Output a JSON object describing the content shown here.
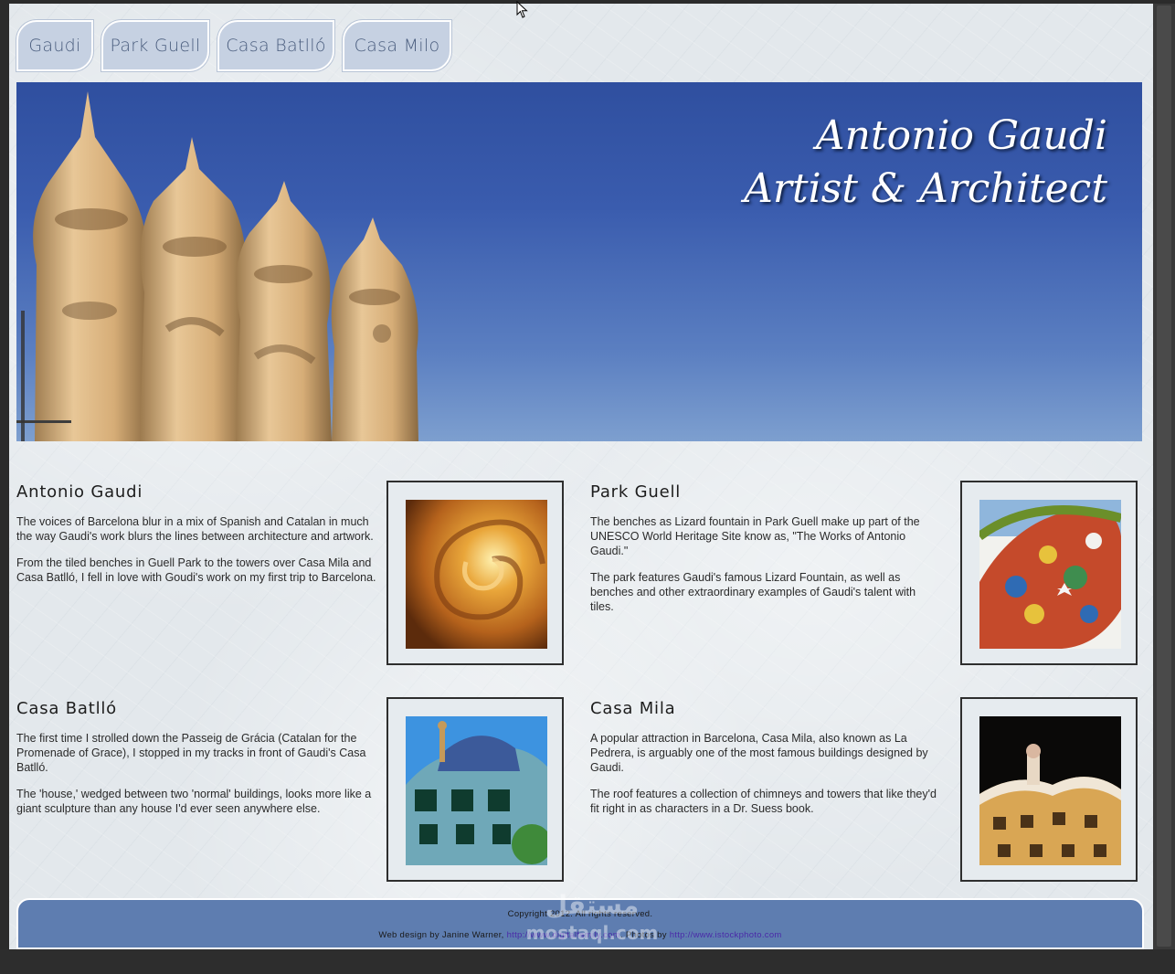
{
  "nav": {
    "tabs": [
      {
        "label": "Gaudi"
      },
      {
        "label": "Park Guell"
      },
      {
        "label": "Casa Batlló"
      },
      {
        "label": "Casa Milo"
      }
    ]
  },
  "hero": {
    "title_line1": "Antonio Gaudi",
    "title_line2": "Artist & Architect"
  },
  "articles": [
    {
      "heading": "Antonio Gaudi",
      "paragraphs": [
        "The voices of Barcelona blur in a mix of Spanish and Catalan in much the way Gaudi's work blurs the lines between architecture and artwork.",
        "From the tiled benches in Guell Park to the towers over Casa Mila and Casa Batlló, I fell in love with Goudi's work on my first trip to Barcelona."
      ]
    },
    {
      "heading": "Park Guell",
      "paragraphs": [
        "The benches as Lizard fountain in Park Guell make up part of the UNESCO World Heritage Site know as, \"The Works of Antonio Gaudi.\"",
        "The park features Gaudi's famous Lizard Fountain, as well as benches and other extraordinary examples of Gaudi's talent with tiles."
      ]
    },
    {
      "heading": "Casa Batlló",
      "paragraphs": [
        "The first time I strolled down the Passeig de Grácia (Catalan for the Promenade of Grace), I stopped in my tracks in front of Gaudi's Casa Batlló.",
        "The 'house,' wedged between two 'normal' buildings, looks more like a giant sculpture than any house I'd ever seen anywhere else."
      ]
    },
    {
      "heading": "Casa Mila",
      "paragraphs": [
        "A popular attraction in Barcelona, Casa Mila, also known as La Pedrera, is arguably one of the most famous buildings designed by Gaudi.",
        "The roof features a collection of chimneys and towers that like they'd fit right in as characters in a Dr. Suess book."
      ]
    }
  ],
  "footer": {
    "copyright": "Copyright 2012. All rights reserved.",
    "credit_prefix": "Web design by Janine Warner,",
    "credit_link1": "http://www.digitalfamily.com",
    "credit_middle": ". Photos by",
    "credit_link2": "http://www.istockphoto.com"
  },
  "watermark": {
    "arabic": "مستقل",
    "latin": "mostaql.com"
  },
  "colors": {
    "tab_bg": "#c6d1e2",
    "tab_text": "#4a5d7e",
    "hero_sky": "#2f4f9f",
    "footer_bg": "#5e7db0",
    "link": "#4a2aa8"
  }
}
